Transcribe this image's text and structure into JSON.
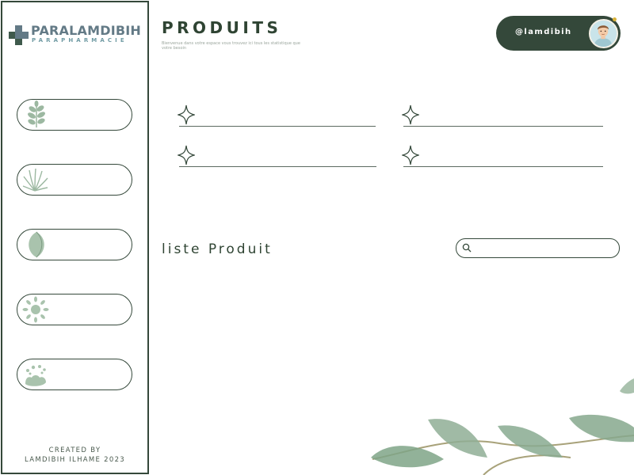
{
  "brand": {
    "name": "PARALAMDIBIH",
    "subtitle": "PARAPHARMACIE"
  },
  "sidebar": {
    "items": [
      {
        "icon": "plant-sprig-icon",
        "label": ""
      },
      {
        "icon": "fern-leaves-icon",
        "label": ""
      },
      {
        "icon": "leaf-icon",
        "label": ""
      },
      {
        "icon": "sun-flower-icon",
        "label": ""
      },
      {
        "icon": "hand-drops-icon",
        "label": ""
      }
    ],
    "credits_line1": "CREATED BY",
    "credits_line2": "LAMDIBIH ILHAME 2023"
  },
  "header": {
    "title": "PRODUITS",
    "subtitle": "Bienvenue dans votre espace vous trouvez ici tous les statistique que votre besoin"
  },
  "user": {
    "handle": "@lamdibih"
  },
  "stats": [
    {
      "icon": "sparkle-icon",
      "value": ""
    },
    {
      "icon": "sparkle-icon",
      "value": ""
    },
    {
      "icon": "sparkle-icon",
      "value": ""
    },
    {
      "icon": "sparkle-icon",
      "value": ""
    }
  ],
  "list": {
    "title": "liste Produit",
    "search_placeholder": "",
    "search_value": ""
  },
  "colors": {
    "primary": "#34483a",
    "leaf": "#9cb8a1",
    "logo_text": "#637a86"
  }
}
